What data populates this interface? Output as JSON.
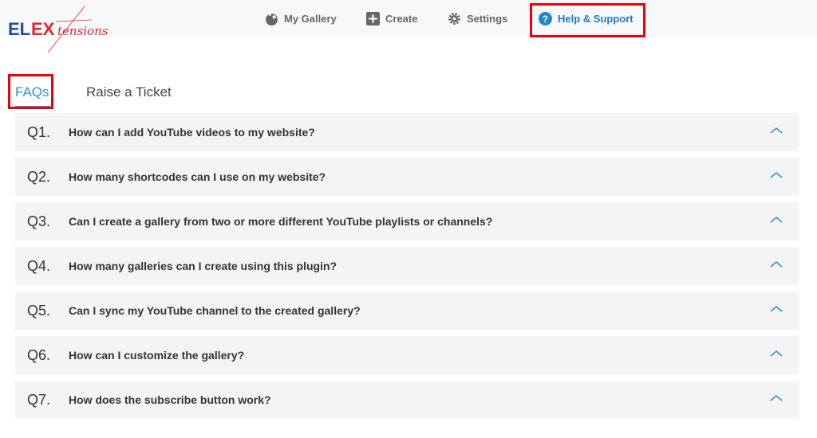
{
  "logo": {
    "text": "ELEXtensions"
  },
  "nav": [
    {
      "label": "My Gallery",
      "icon": "gallery-icon"
    },
    {
      "label": "Create",
      "icon": "plus-square-icon"
    },
    {
      "label": "Settings",
      "icon": "gear-icon"
    },
    {
      "label": "Help & Support",
      "icon": "help-circle-icon",
      "active": true
    }
  ],
  "colors": {
    "accent": "#2f8fd8",
    "highlight": "#e8000b",
    "row_bg": "#f4f4f4"
  },
  "tabs": [
    {
      "label": "FAQs",
      "active": true
    },
    {
      "label": "Raise a Ticket"
    }
  ],
  "faqs": [
    {
      "num": "Q1.",
      "question": "How can I add YouTube videos to my website?"
    },
    {
      "num": "Q2.",
      "question": "How many shortcodes can I use on my website?"
    },
    {
      "num": "Q3.",
      "question": "Can I create a gallery from two or more different YouTube playlists or channels?"
    },
    {
      "num": "Q4.",
      "question": "How many galleries can I create using this plugin?"
    },
    {
      "num": "Q5.",
      "question": "Can I sync my YouTube channel to the created gallery?"
    },
    {
      "num": "Q6.",
      "question": "How can I customize the gallery?"
    },
    {
      "num": "Q7.",
      "question": "How does the subscribe button work?"
    }
  ]
}
